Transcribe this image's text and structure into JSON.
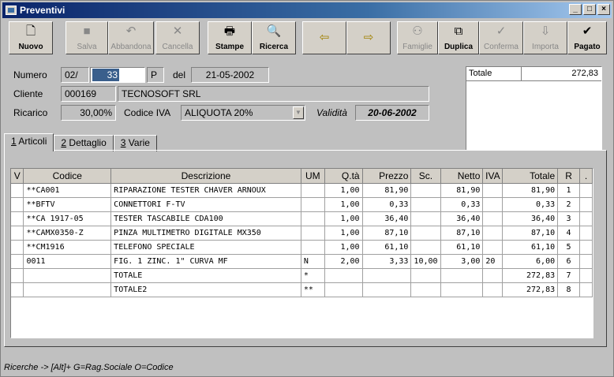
{
  "window": {
    "title": "Preventivi"
  },
  "toolbar": {
    "nuovo": "Nuovo",
    "salva": "Salva",
    "abbandona": "Abbandona",
    "cancella": "Cancella",
    "stampe": "Stampe",
    "ricerca": "Ricerca",
    "famiglie": "Famiglie",
    "duplica": "Duplica",
    "conferma": "Conferma",
    "importa": "Importa",
    "pagato": "Pagato"
  },
  "form": {
    "numero_label": "Numero",
    "numero_prefix": "02/",
    "numero_value": "33",
    "numero_suffix": "P",
    "del_label": "del",
    "data": "21-05-2002",
    "cliente_label": "Cliente",
    "cliente_code": "000169",
    "cliente_name": "TECNOSOFT SRL",
    "ricarico_label": "Ricarico",
    "ricarico_value": "30,00%",
    "iva_label": "Codice IVA",
    "iva_value": "ALIQUOTA 20%",
    "validita_label": "Validità",
    "validita_value": "20-06-2002"
  },
  "totale_box": {
    "label": "Totale",
    "value": "272,83"
  },
  "tabs": [
    {
      "key": "1",
      "label": " Articoli"
    },
    {
      "key": "2",
      "label": " Dettaglio"
    },
    {
      "key": "3",
      "label": " Varie"
    }
  ],
  "grid": {
    "columns": [
      "V",
      "Codice",
      "Descrizione",
      "UM",
      "Q.tà",
      "Prezzo",
      "Sc.",
      "Netto",
      "IVA",
      "Totale",
      "R",
      "."
    ],
    "rows": [
      [
        "",
        "**CA001",
        "RIPARAZIONE TESTER CHAVER ARNOUX",
        "",
        "1,00",
        "81,90",
        "",
        "81,90",
        "",
        "81,90",
        "1",
        ""
      ],
      [
        "",
        "**BFTV",
        "CONNETTORI F-TV",
        "",
        "1,00",
        "0,33",
        "",
        "0,33",
        "",
        "0,33",
        "2",
        ""
      ],
      [
        "",
        "**CA 1917-05",
        "TESTER TASCABILE CDA100",
        "",
        "1,00",
        "36,40",
        "",
        "36,40",
        "",
        "36,40",
        "3",
        ""
      ],
      [
        "",
        "**CAMX0350-Z",
        "PINZA MULTIMETRO DIGITALE MX350",
        "",
        "1,00",
        "87,10",
        "",
        "87,10",
        "",
        "87,10",
        "4",
        ""
      ],
      [
        "",
        "**CM1916",
        "TELEFONO SPECIALE",
        "",
        "1,00",
        "61,10",
        "",
        "61,10",
        "",
        "61,10",
        "5",
        ""
      ],
      [
        "",
        "0011",
        "FIG. 1 ZINC. 1\"  CURVA MF",
        "N",
        "2,00",
        "3,33",
        "10,00",
        "3,00",
        "20",
        "6,00",
        "6",
        ""
      ],
      [
        "",
        "",
        "TOTALE",
        "*",
        "",
        "",
        "",
        "",
        "",
        "272,83",
        "7",
        ""
      ],
      [
        "",
        "",
        "TOTALE2",
        "**",
        "",
        "",
        "",
        "",
        "",
        "272,83",
        "8",
        ""
      ]
    ]
  },
  "status": "Ricerche -> [Alt]+ G=Rag.Sociale O=Codice"
}
